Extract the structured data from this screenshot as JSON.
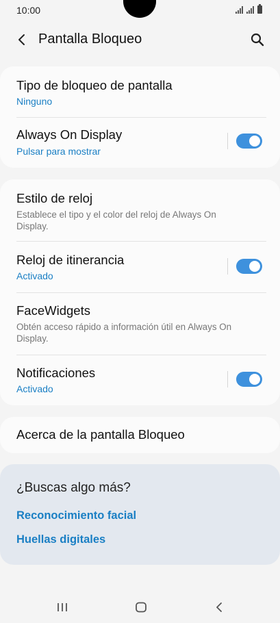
{
  "status_bar": {
    "time": "10:00"
  },
  "app_bar": {
    "title": "Pantalla Bloqueo",
    "back_icon": "back-arrow-icon",
    "search_icon": "search-icon"
  },
  "card1": {
    "items": [
      {
        "title": "Tipo de bloqueo de pantalla",
        "subtitle": "Ninguno"
      },
      {
        "title": "Always On Display",
        "subtitle": "Pulsar para mostrar",
        "toggle": true
      }
    ]
  },
  "card2": {
    "items": [
      {
        "title": "Estilo de reloj",
        "description": "Establece el tipo y el color del reloj de Always On Display."
      },
      {
        "title": "Reloj de itinerancia",
        "subtitle": "Activado",
        "toggle": true
      },
      {
        "title": "FaceWidgets",
        "description": "Obtén acceso rápido a información útil en Always On Display."
      },
      {
        "title": "Notificaciones",
        "subtitle": "Activado",
        "toggle": true
      }
    ]
  },
  "card3": {
    "title": "Acerca de la pantalla Bloqueo"
  },
  "more": {
    "title": "¿Buscas algo más?",
    "links": [
      "Reconocimiento facial",
      "Huellas digitales"
    ]
  },
  "nav_bar": {
    "recents_icon": "recents-icon",
    "home_icon": "home-icon",
    "back_icon": "nav-back-icon"
  },
  "colors": {
    "accent": "#1a7fc4",
    "toggle_on": "#3e91dd",
    "background": "#f4f4f4",
    "card": "#fbfbfb",
    "suggestion_card": "#e3e8ef"
  }
}
